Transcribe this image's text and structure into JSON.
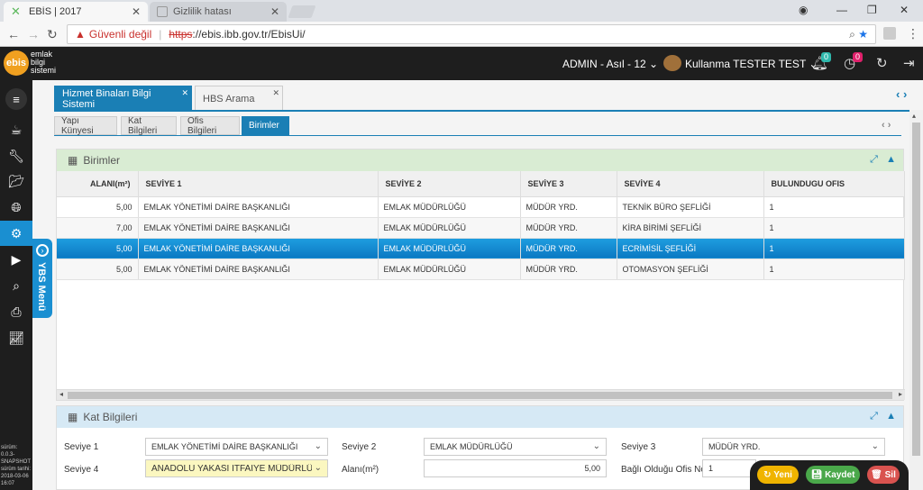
{
  "browser": {
    "tabs": [
      {
        "label": "EBİS | 2017"
      },
      {
        "label": "Gizlilik hatası"
      }
    ],
    "security_label": "Güvenli değil",
    "url_scheme": "https",
    "url_rest": "://ebis.ibb.gov.tr/EbisUi/"
  },
  "header": {
    "logo": "ebis",
    "logo_text": [
      "emlak",
      "bilgi",
      "sistemi"
    ],
    "context": "ADMIN - Asıl - 12",
    "user": "Kullanma TESTER TEST",
    "notif_count": "0",
    "task_count": "0"
  },
  "sidebar": {
    "version_text": [
      "sürüm:",
      "0.0.3-",
      "SNAPSHOT",
      "sürüm tarihi:",
      "2018-03-06",
      "16:07"
    ],
    "ybs_label": "YBS Menü"
  },
  "module_tabs": [
    {
      "label": "Hizmet Binaları Bilgi Sistemi",
      "active": true
    },
    {
      "label": "HBS Arama",
      "active": false
    }
  ],
  "sub_tabs": [
    {
      "label": "Yapı Künyesi"
    },
    {
      "label": "Kat Bilgileri"
    },
    {
      "label": "Ofis Bilgileri"
    },
    {
      "label": "Birimler",
      "active": true
    }
  ],
  "birimler": {
    "title": "Birimler",
    "columns": [
      "ALANI(m²)",
      "SEVİYE 1",
      "SEVİYE 2",
      "SEVİYE 3",
      "SEVİYE 4",
      "BULUNDUGU OFIS"
    ],
    "rows": [
      [
        "5,00",
        "EMLAK YÖNETİMİ DAİRE BAŞKANLIĞI",
        "EMLAK MÜDÜRLÜĞÜ",
        "MÜDÜR YRD.",
        "TEKNİK BÜRO ŞEFLİĞİ",
        "1"
      ],
      [
        "7,00",
        "EMLAK YÖNETİMİ DAİRE BAŞKANLIĞI",
        "EMLAK MÜDÜRLÜĞÜ",
        "MÜDÜR YRD.",
        "KİRA BİRİMİ ŞEFLİĞİ",
        "1"
      ],
      [
        "5,00",
        "EMLAK YÖNETİMİ DAİRE BAŞKANLIĞI",
        "EMLAK MÜDÜRLÜĞÜ",
        "MÜDÜR YRD.",
        "ECRİMİSİL ŞEFLİĞİ",
        "1"
      ],
      [
        "5,00",
        "EMLAK YÖNETİMİ DAİRE BAŞKANLIĞI",
        "EMLAK MÜDÜRLÜĞÜ",
        "MÜDÜR YRD.",
        "OTOMASYON ŞEFLİĞİ",
        "1"
      ]
    ],
    "selected_row": 2
  },
  "kat_bilgileri": {
    "title": "Kat Bilgileri",
    "fields": {
      "seviye1_label": "Seviye 1",
      "seviye1_value": "EMLAK YÖNETİMİ DAİRE BAŞKANLIĞI",
      "seviye2_label": "Seviye 2",
      "seviye2_value": "EMLAK MÜDÜRLÜĞÜ",
      "seviye3_label": "Seviye 3",
      "seviye3_value": "MÜDÜR YRD.",
      "seviye4_label": "Seviye 4",
      "seviye4_value": "ANADOLU YAKASI İTFAİYE MÜDÜRLÜĞÜ (",
      "alani_label": "Alanı(m²)",
      "alani_value": "5,00",
      "ofis_label": "Bağlı Olduğu Ofis No",
      "ofis_value": "1"
    }
  },
  "actions": {
    "yeni": "Yeni",
    "kaydet": "Kaydet",
    "sil": "Sil"
  },
  "colors": {
    "accent": "#1a7fb5",
    "selected_row": "#1f9ee0",
    "header_bg": "#1e1e1e",
    "yeni": "#f0b400",
    "kaydet": "#4aa84a",
    "sil": "#d9534f"
  }
}
